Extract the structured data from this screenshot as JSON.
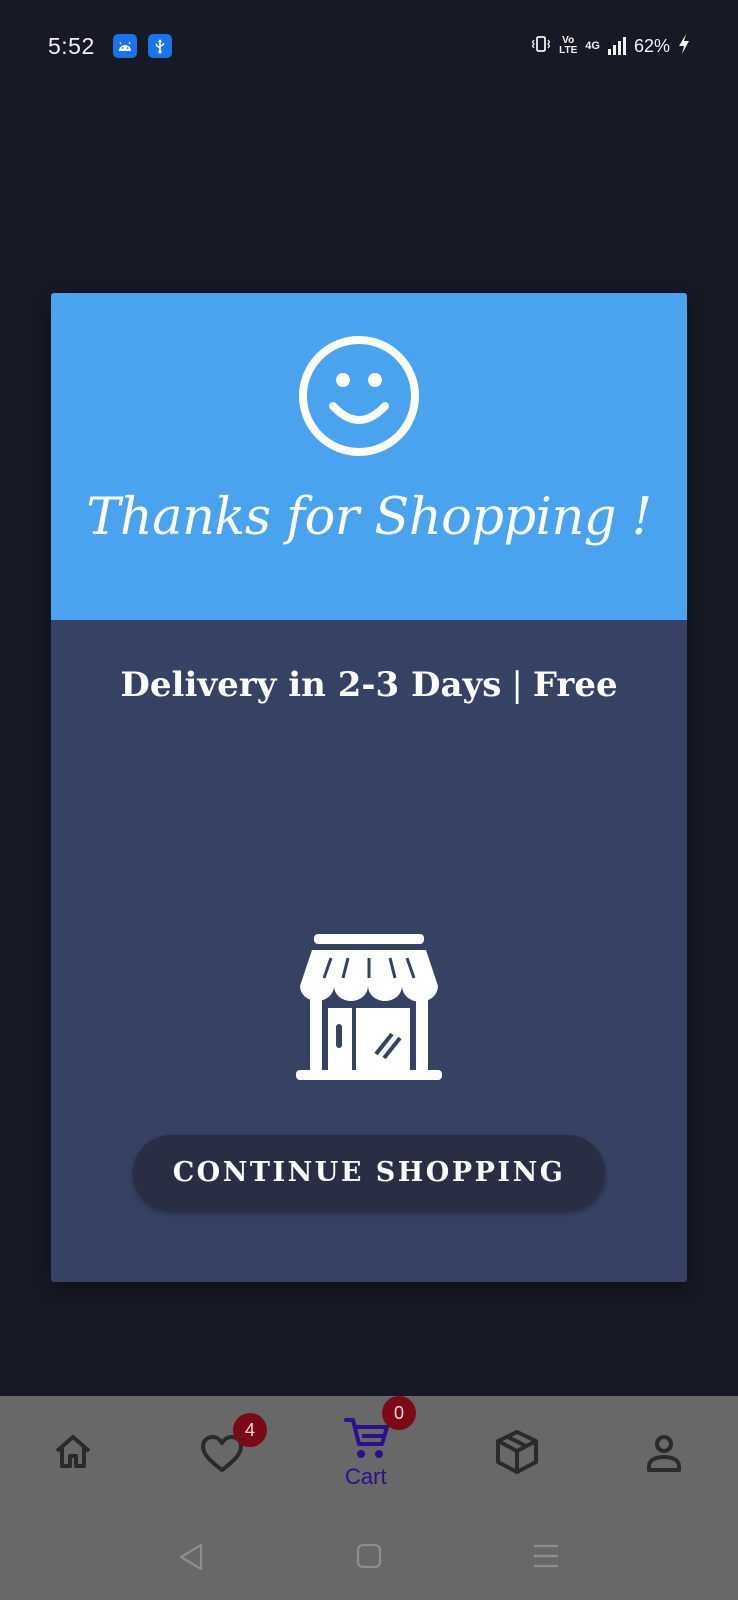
{
  "status_bar": {
    "time": "5:52",
    "notification_icons": [
      "android-icon",
      "usb-icon"
    ],
    "volte_label": "Vo\nLTE",
    "network_label": "4G",
    "battery_percent": "62%"
  },
  "card": {
    "header_color": "#4aa3ef",
    "body_color": "#364263",
    "title": "Thanks for Shopping !",
    "delivery_text": "Delivery in 2-3 Days",
    "delivery_separator": "|",
    "delivery_cost": "Free",
    "continue_button_label": "CONTINUE SHOPPING"
  },
  "bottom_nav": {
    "items": [
      {
        "icon": "home-icon"
      },
      {
        "icon": "heart-icon",
        "badge": "4"
      },
      {
        "icon": "cart-icon",
        "badge": "0",
        "label": "Cart",
        "active": true
      },
      {
        "icon": "package-icon"
      },
      {
        "icon": "user-icon"
      }
    ],
    "active_color": "#2e0f8a",
    "badge_color": "#7a0a17"
  },
  "system_nav": {
    "buttons": [
      "back-icon",
      "home-square-icon",
      "menu-icon"
    ]
  }
}
